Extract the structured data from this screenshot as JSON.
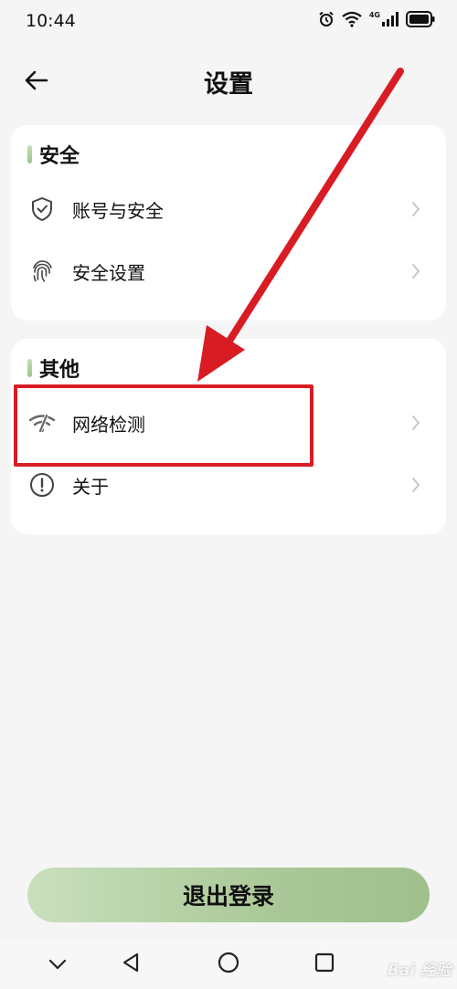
{
  "status_bar": {
    "time": "10:44",
    "network": "4G"
  },
  "header": {
    "title": "设置"
  },
  "sections": [
    {
      "title": "安全",
      "items": [
        {
          "label": "账号与安全",
          "icon": "shield-check-icon"
        },
        {
          "label": "安全设置",
          "icon": "fingerprint-icon"
        }
      ]
    },
    {
      "title": "其他",
      "items": [
        {
          "label": "网络检测",
          "icon": "wifi-slash-icon"
        },
        {
          "label": "关于",
          "icon": "info-circle-icon"
        }
      ]
    }
  ],
  "logout": {
    "label": "退出登录"
  },
  "watermark": {
    "text": "Bai 经验"
  },
  "colors": {
    "accent_start": "#c9dfbd",
    "accent_end": "#9fc08c",
    "annotation_red": "#d91c24",
    "background": "#f5f5f5"
  }
}
